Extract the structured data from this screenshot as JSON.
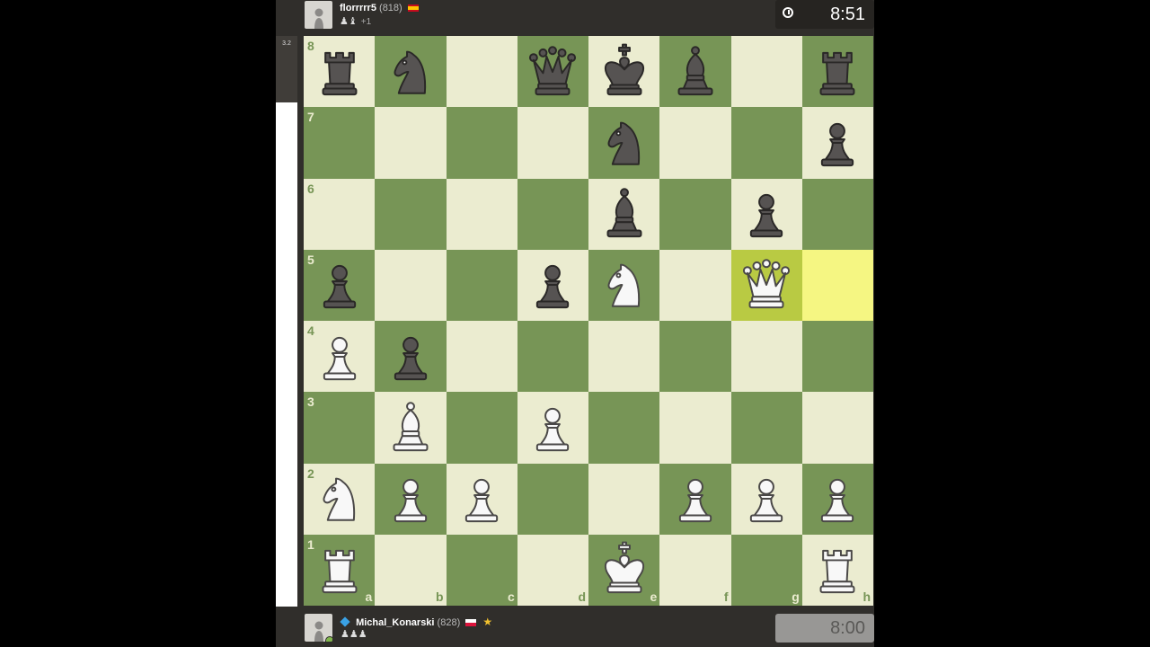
{
  "top_player": {
    "name": "florrrrr5",
    "rating": "(818)",
    "captured": "♟♝",
    "advantage": "+1",
    "clock": "8:51"
  },
  "bottom_player": {
    "name": "Michal_Konarski",
    "rating": "(828)",
    "captured": "♟♟♟",
    "clock": "8:00"
  },
  "eval": {
    "score": "3.2"
  },
  "colors": {
    "light_square": "#ebecd0",
    "dark_square": "#779556",
    "highlight_light": "#f5f682",
    "highlight_dark": "#b9ca43"
  },
  "board": {
    "ranks": [
      "8",
      "7",
      "6",
      "5",
      "4",
      "3",
      "2",
      "1"
    ],
    "files": [
      "a",
      "b",
      "c",
      "d",
      "e",
      "f",
      "g",
      "h"
    ],
    "highlighted": [
      "g5",
      "h5"
    ],
    "pieces": {
      "a8": "bR",
      "b8": "bN",
      "d8": "bQ",
      "e8": "bK",
      "f8": "bB",
      "h8": "bR",
      "e7": "bN",
      "h7": "bP",
      "e6": "bB",
      "g6": "bP",
      "a5": "bP",
      "d5": "bP",
      "e5": "wN",
      "g5": "wQ",
      "a4": "wP",
      "b4": "bP",
      "b3": "wB",
      "d3": "wP",
      "a2": "wN",
      "b2": "wP",
      "c2": "wP",
      "f2": "wP",
      "g2": "wP",
      "h2": "wP",
      "a1": "wR",
      "e1": "wK",
      "h1": "wR"
    }
  }
}
